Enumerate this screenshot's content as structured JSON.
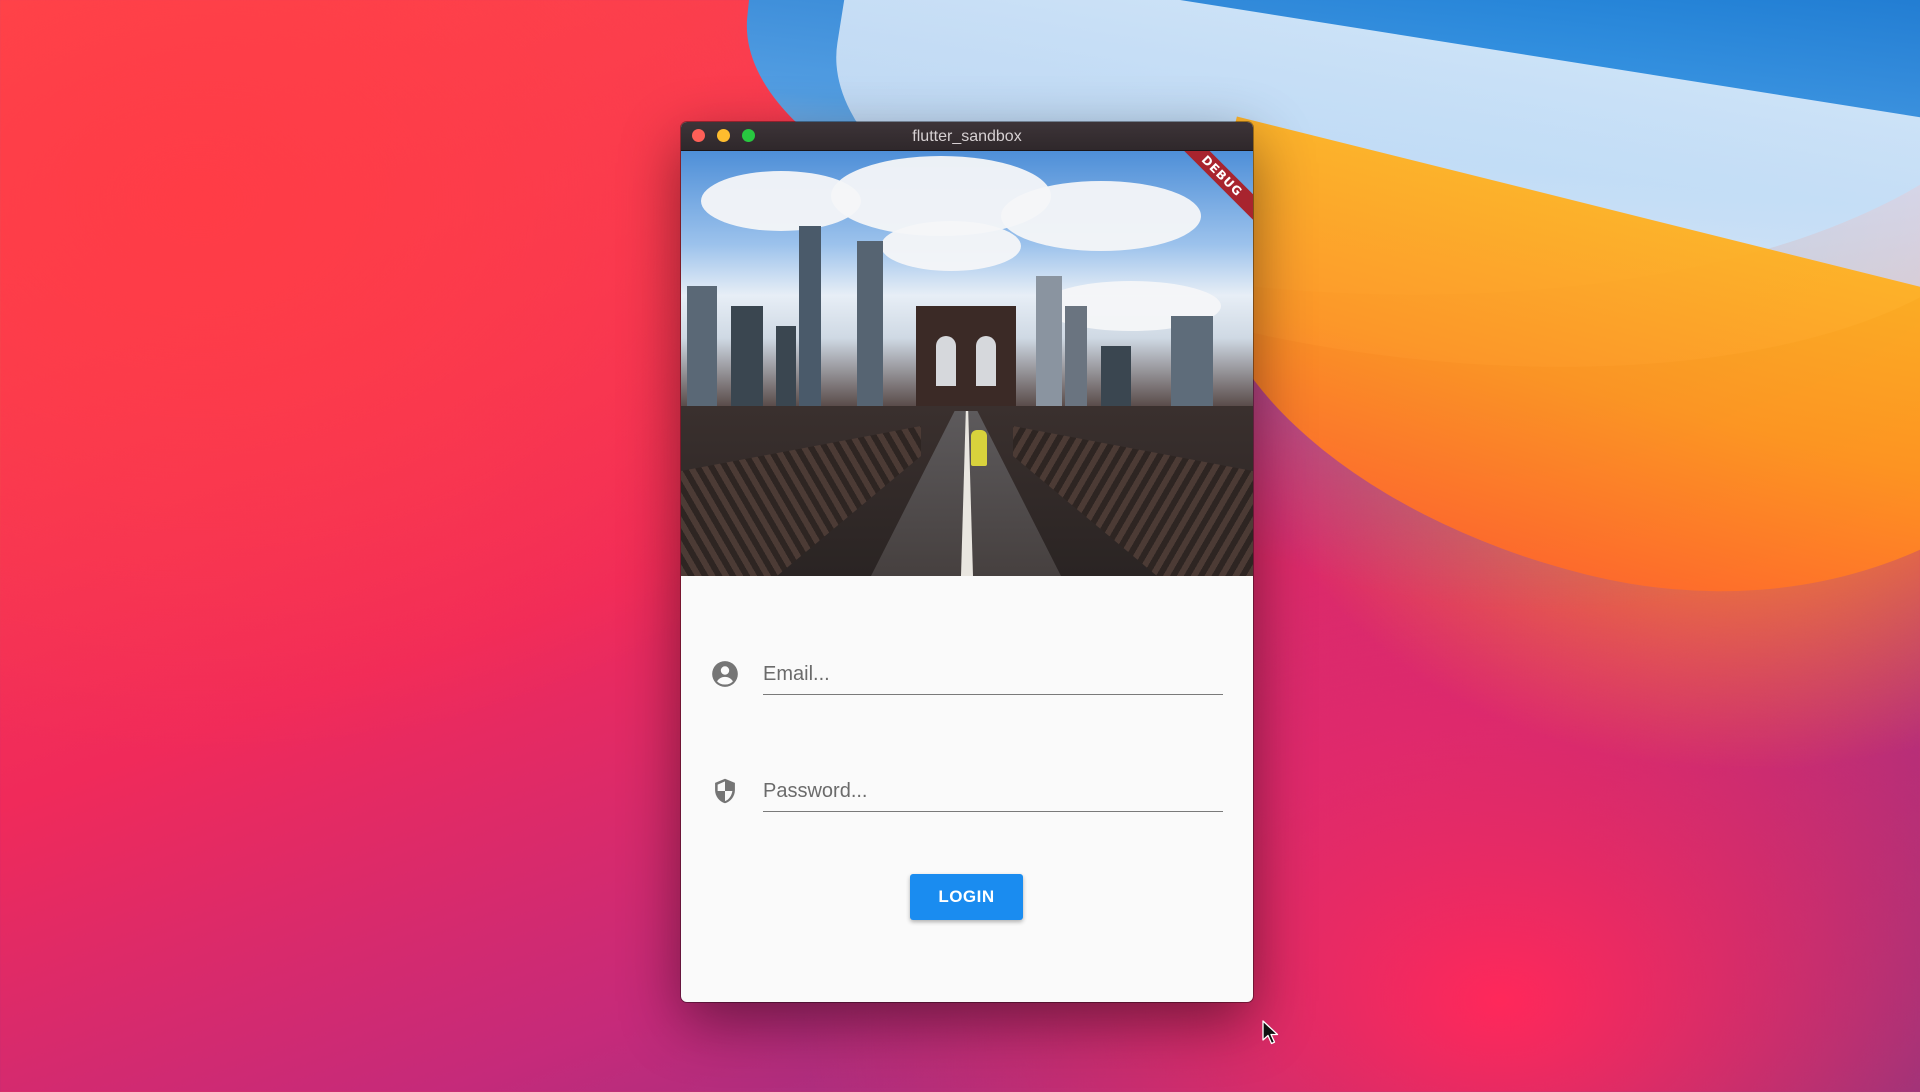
{
  "window": {
    "title": "flutter_sandbox",
    "debug_banner": "DEBUG"
  },
  "login_form": {
    "email_placeholder": "Email...",
    "password_placeholder": "Password...",
    "email_icon": "account-circle-icon",
    "password_icon": "shield-icon",
    "login_label": "LOGIN"
  },
  "colors": {
    "accent": "#1a8cf0",
    "debug_banner": "#a8242e"
  }
}
